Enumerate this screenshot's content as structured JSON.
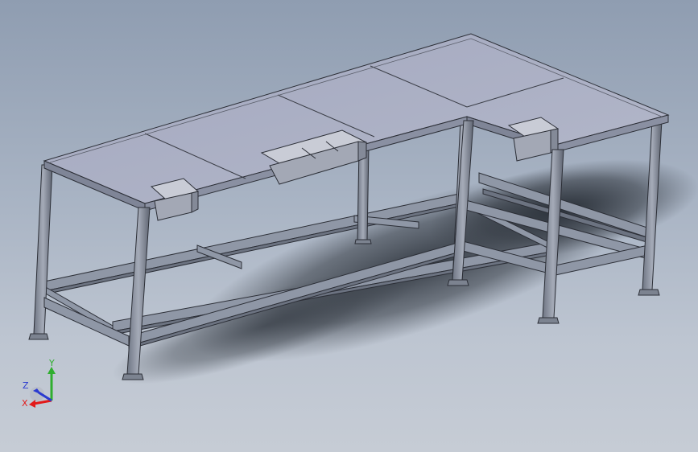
{
  "viewport": {
    "background_top": "#8f9db1",
    "background_bottom": "#c6ccd5",
    "model": {
      "name": "l-shaped-workbench",
      "top_color": "#a6abc0",
      "frame_color": "#8f97a6",
      "edge_color": "#2c2f37",
      "shadow_color": "#2f353d"
    },
    "triad": {
      "x_label": "X",
      "y_label": "Y",
      "z_label": "Z",
      "x_color": "#e21a1a",
      "y_color": "#2fae2f",
      "z_color": "#2b3bd0"
    }
  }
}
